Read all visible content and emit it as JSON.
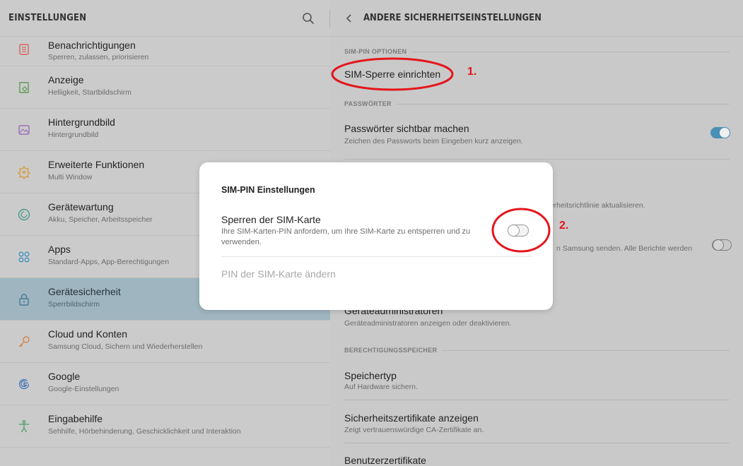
{
  "left": {
    "title": "EINSTELLUNGEN",
    "items": [
      {
        "icon": "notifications-icon",
        "label": "Benachrichtigungen",
        "sub": "Sperren, zulassen, priorisieren"
      },
      {
        "icon": "display-icon",
        "label": "Anzeige",
        "sub": "Helligkeit, Startbildschirm"
      },
      {
        "icon": "wallpaper-icon",
        "label": "Hintergrundbild",
        "sub": "Hintergrundbild"
      },
      {
        "icon": "advanced-features-icon",
        "label": "Erweiterte Funktionen",
        "sub": "Multi Window"
      },
      {
        "icon": "device-maintenance-icon",
        "label": "Gerätewartung",
        "sub": "Akku, Speicher, Arbeitsspeicher"
      },
      {
        "icon": "apps-icon",
        "label": "Apps",
        "sub": "Standard-Apps, App-Berechtigungen"
      },
      {
        "icon": "lock-icon",
        "label": "Gerätesicherheit",
        "sub": "Sperrbildschirm",
        "selected": true
      },
      {
        "icon": "key-icon",
        "label": "Cloud und Konten",
        "sub": "Samsung Cloud, Sichern und Wiederherstellen"
      },
      {
        "icon": "google-icon",
        "label": "Google",
        "sub": "Google-Einstellungen"
      },
      {
        "icon": "accessibility-icon",
        "label": "Eingabehilfe",
        "sub": "Sehhilfe, Hörbehinderung, Geschicklichkeit und Interaktion"
      }
    ]
  },
  "right": {
    "title": "ANDERE SICHERHEITSEINSTELLUNGEN",
    "sim_pin_section": "SIM-PIN OPTIONEN",
    "sim_lock_setup": "SIM-Sperre einrichten",
    "passwords_section": "PASSWÖRTER",
    "show_passwords": "Passwörter sichtbar machen",
    "show_passwords_sub": "Zeichen des Passworts beim Eingeben kurz anzeigen.",
    "show_passwords_on": true,
    "policy_sub_partial": "herheitsrichtlinie aktualisieren.",
    "reports_sub_partial": "n Samsung senden. Alle Berichte werden",
    "reports_on": false,
    "device_admins": "Geräteadministratoren",
    "device_admins_sub": "Geräteadministratoren anzeigen oder deaktivieren.",
    "credential_section": "BERECHTIGUNGSSPEICHER",
    "storage_type": "Speichertyp",
    "storage_type_sub": "Auf Hardware sichern.",
    "certs": "Sicherheitszertifikate anzeigen",
    "certs_sub": "Zeigt vertrauenswürdige CA-Zertifikate an.",
    "user_certs": "Benutzerzertifikate"
  },
  "dialog": {
    "title": "SIM-PIN Einstellungen",
    "lock_sim": "Sperren der SIM-Karte",
    "lock_sim_sub": "Ihre SIM-Karten-PIN anfordern, um Ihre SIM-Karte zu entsperren und zu verwenden.",
    "lock_sim_on": false,
    "change_pin": "PIN der SIM-Karte ändern"
  },
  "annotations": {
    "step1": "1.",
    "step2": "2.",
    "color": "#e5141b"
  },
  "colors": {
    "selected_bg": "#9fb5bf",
    "toggle_on": "#4a8fb6"
  }
}
